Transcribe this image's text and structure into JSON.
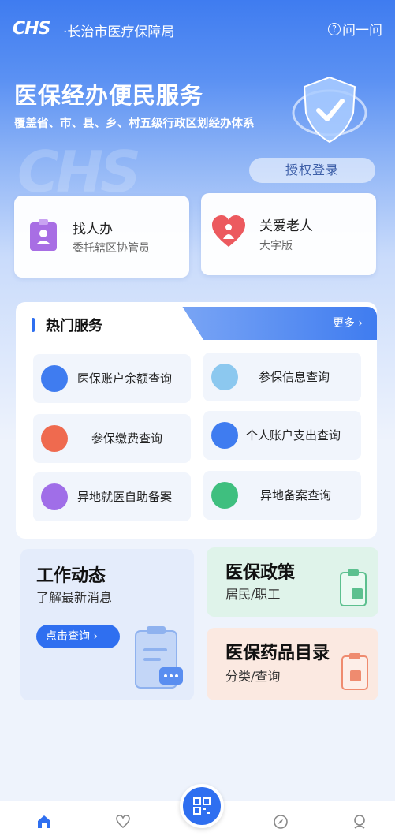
{
  "header": {
    "logo": "CHS",
    "bureau": "·长治市医疗保障局",
    "ask_label": "问一问"
  },
  "hero": {
    "title": "医保经办便民服务",
    "subtitle": "覆盖省、市、县、乡、村五级行政区划经办体系",
    "auth_button": "授权登录"
  },
  "quick_cards": [
    {
      "title": "找人办",
      "sub": "委托辖区协管员",
      "icon": "person-card-icon"
    },
    {
      "title": "关爱老人",
      "sub": "大字版",
      "icon": "elder-heart-icon"
    }
  ],
  "hot_services": {
    "title": "热门服务",
    "more": "更多",
    "items": [
      {
        "label": "医保账户余额查询",
        "icon": "wallet-icon",
        "color": "#3f7cf0"
      },
      {
        "label": "参保信息查询",
        "icon": "document-search-icon",
        "color": "#5fb0e8"
      },
      {
        "label": "参保缴费查询",
        "icon": "payment-box-icon",
        "color": "#ef6a4f"
      },
      {
        "label": "个人账户支出查询",
        "icon": "card-icon",
        "color": "#3f7cf0"
      },
      {
        "label": "异地就医自助备案",
        "icon": "record-badge-icon",
        "color": "#a06ee8"
      },
      {
        "label": "异地备案查询",
        "icon": "shield-badge-icon",
        "color": "#3fbf7f"
      }
    ]
  },
  "tiles": {
    "news": {
      "title": "工作动态",
      "sub": "了解最新消息",
      "button": "点击查询"
    },
    "policy": {
      "title": "医保政策",
      "sub": "居民/职工"
    },
    "drugs": {
      "title": "医保药品目录",
      "sub": "分类/查询"
    }
  },
  "tabbar": {
    "items": [
      "home-icon",
      "heart-icon",
      "qr-code-icon",
      "compass-icon",
      "profile-icon"
    ]
  }
}
